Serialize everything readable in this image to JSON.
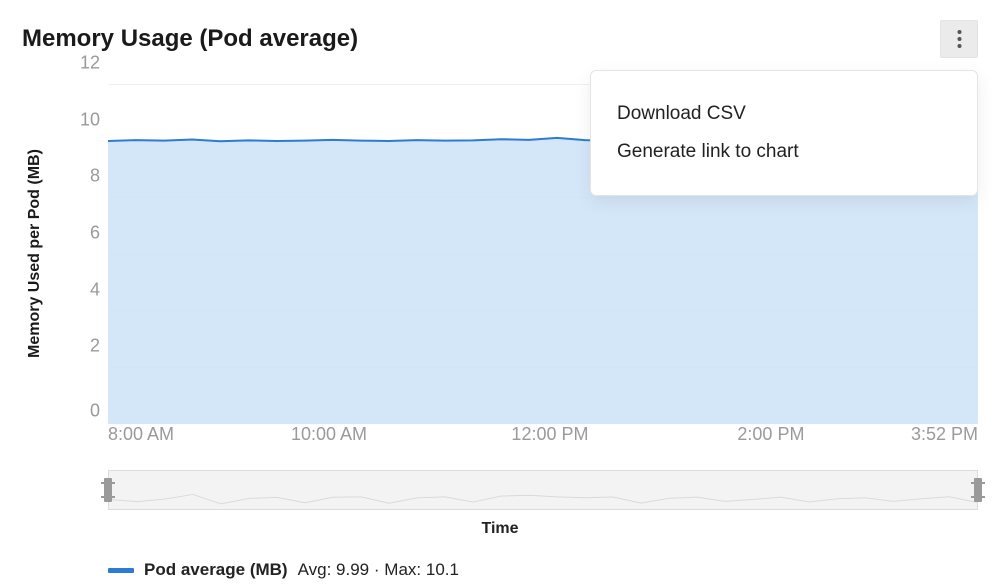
{
  "header": {
    "title": "Memory Usage (Pod average)"
  },
  "menu": {
    "items": [
      {
        "label": "Download CSV"
      },
      {
        "label": "Generate link to chart"
      }
    ]
  },
  "chart": {
    "ylabel": "Memory Used per Pod (MB)",
    "xlabel": "Time",
    "y_ticks": [
      "0",
      "2",
      "4",
      "6",
      "8",
      "10",
      "12"
    ],
    "x_ticks": [
      "8:00 AM",
      "10:00 AM",
      "12:00 PM",
      "2:00 PM",
      "3:52 PM"
    ]
  },
  "legend": {
    "swatch_color": "#2d7bd4",
    "name": "Pod average (MB)",
    "avg_label": "Avg:",
    "avg_value": "9.99",
    "sep": "·",
    "max_label": "Max:",
    "max_value": "10.1"
  },
  "chart_data": {
    "type": "area",
    "title": "Memory Usage (Pod average)",
    "xlabel": "Time",
    "ylabel": "Memory Used per Pod (MB)",
    "ylim": [
      0,
      12
    ],
    "x": [
      "8:00 AM",
      "8:15 AM",
      "8:30 AM",
      "8:45 AM",
      "9:00 AM",
      "9:15 AM",
      "9:30 AM",
      "9:45 AM",
      "10:00 AM",
      "10:15 AM",
      "10:30 AM",
      "10:45 AM",
      "11:00 AM",
      "11:15 AM",
      "11:30 AM",
      "11:45 AM",
      "12:00 PM",
      "12:15 PM",
      "12:30 PM",
      "12:45 PM",
      "1:00 PM",
      "1:15 PM",
      "1:30 PM",
      "1:45 PM",
      "2:00 PM",
      "2:15 PM",
      "2:30 PM",
      "2:45 PM",
      "3:00 PM",
      "3:15 PM",
      "3:30 PM",
      "3:52 PM"
    ],
    "series": [
      {
        "name": "Pod average (MB)",
        "avg": 9.99,
        "max": 10.1,
        "values": [
          9.99,
          10.02,
          10.0,
          10.04,
          9.98,
          10.01,
          9.99,
          10.0,
          10.03,
          10.0,
          9.99,
          10.02,
          10.0,
          10.01,
          10.05,
          10.03,
          10.1,
          10.02,
          10.0,
          9.99,
          10.01,
          10.0,
          10.02,
          9.99,
          10.0,
          10.01,
          10.0,
          9.99,
          10.02,
          10.0,
          10.01,
          10.0
        ]
      }
    ],
    "x_tick_positions_pct": [
      0,
      25.4,
      50.8,
      76.2,
      100
    ]
  }
}
